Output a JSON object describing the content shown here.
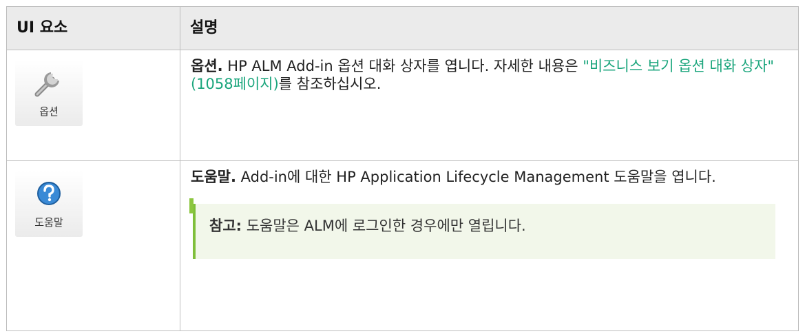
{
  "table": {
    "header": {
      "col1": "UI 요소",
      "col2": "설명"
    },
    "rows": [
      {
        "icon_name": "wrench-icon",
        "icon_label": "옵션",
        "title": "옵션.",
        "text": " HP ALM Add-in 옵션 대화 상자를 엽니다. 자세한 내용은 ",
        "link_text": "\"비즈니스 보기 옵션 대화 상자\"(1058페이지)",
        "text_after": "를 참조하십시오."
      },
      {
        "icon_name": "help-icon",
        "icon_label": "도움말",
        "title": "도움말.",
        "text": " Add-in에 대한 HP Application Lifecycle Management 도움말을 엽니다.",
        "note": {
          "label": "참고:",
          "text": " 도움말은 ALM에 로그인한 경우에만 열립니다."
        }
      }
    ]
  },
  "colors": {
    "link": "#1aa57c",
    "note_accent": "#8cc63f",
    "note_bg": "#f2f7ea",
    "header_bg": "#ebebeb"
  }
}
